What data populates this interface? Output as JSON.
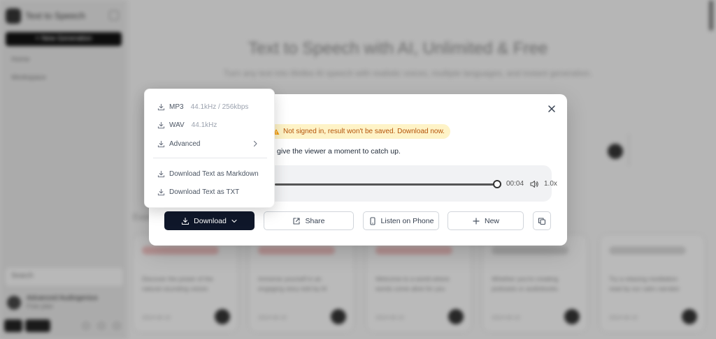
{
  "sidebar": {
    "app_title": "Text to Speech",
    "new_button": "+ New Generation",
    "items": [
      "Home",
      "Workspace"
    ],
    "search": "Search",
    "user_name": "Advanced Audiogenius",
    "user_plan": "Free plan"
  },
  "main": {
    "title": "Text to Speech with AI, Unlimited & Free",
    "subtitle": "Turn any text into lifelike AI speech with realistic voices, multiple languages, and instant generation.",
    "section_label": "Examples",
    "cards": [
      {
        "line1": "Discover the power of the",
        "line2": "natural sounding voices",
        "date": "2024-06-10"
      },
      {
        "line1": "Immerse yourself in an",
        "line2": "engaging story told by AI",
        "date": "2024-06-10"
      },
      {
        "line1": "Welcome to a world where",
        "line2": "words come alive for you",
        "date": "2024-06-10"
      },
      {
        "line1": "Whether you're creating",
        "line2": "podcasts or audiobooks",
        "date": "2024-06-10"
      },
      {
        "line1": "Try a relaxing meditation",
        "line2": "read by our calm narrator",
        "date": "2024-06-10"
      }
    ]
  },
  "modal": {
    "warning": "Not signed in, result won't be saved. Download now.",
    "text_snippet": "give the viewer a moment to catch up.",
    "player": {
      "time": "00:04",
      "speed": "1.0x",
      "progress": 1.0
    },
    "buttons": {
      "download": "Download",
      "share": "Share",
      "listen_on_phone": "Listen on Phone",
      "new": "New"
    }
  },
  "download_menu": {
    "mp3_label": "MP3",
    "mp3_hint": "44.1kHz / 256kbps",
    "wav_label": "WAV",
    "wav_hint": "44.1kHz",
    "advanced_label": "Advanced",
    "markdown_label": "Download Text as Markdown",
    "txt_label": "Download Text as TXT"
  },
  "colors": {
    "primary_dark": "#0f172a",
    "warning_bg": "#fef3c7",
    "warning_text": "#b45309"
  },
  "icons": [
    "download-icon",
    "chevron-down-icon",
    "chevron-right-icon",
    "share-icon",
    "phone-icon",
    "plus-icon",
    "copy-icon",
    "close-icon",
    "volume-icon",
    "warning-icon"
  ]
}
